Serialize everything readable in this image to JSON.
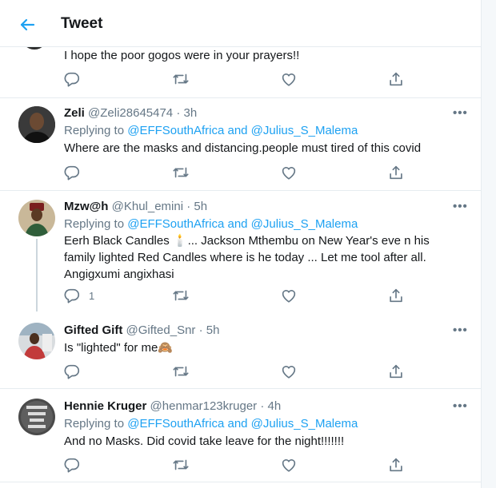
{
  "header": {
    "title": "Tweet"
  },
  "top_partial": {
    "text": "I hope the poor gogos were in your prayers!!"
  },
  "tweets": [
    {
      "name": "Zeli",
      "handle": "@Zeli28645474",
      "time": "· 3h",
      "replying_prefix": "Replying to ",
      "replying_to": "@EFFSouthAfrica and @Julius_S_Malema",
      "text": "Where are the masks and distancing.people must tired of this covid",
      "reply_count": ""
    },
    {
      "name": "Mzw@h",
      "handle": "@Khul_emini",
      "time": "· 5h",
      "replying_prefix": "Replying to ",
      "replying_to": "@EFFSouthAfrica and @Julius_S_Malema",
      "text": "Eerh Black Candles 🕯️... Jackson Mthembu on New Year's eve n his family lighted Red Candles where is he today ... Let me tool after all. Angigxumi angixhasi",
      "reply_count": "1"
    },
    {
      "name": "Gifted Gift",
      "handle": "@Gifted_Snr",
      "time": "· 5h",
      "text": "Is \"lighted\" for me🙈",
      "reply_count": ""
    },
    {
      "name": "Hennie Kruger",
      "handle": "@henmar123kruger",
      "time": "· 4h",
      "replying_prefix": "Replying to ",
      "replying_to": "@EFFSouthAfrica and @Julius_S_Malema",
      "text": "And no Masks. Did covid take leave for the night!!!!!!!",
      "reply_count": ""
    }
  ],
  "icons": {
    "reply": "reply-icon",
    "retweet": "retweet-icon",
    "like": "like-icon",
    "share": "share-icon",
    "more": "more-icon",
    "back": "back-arrow-icon"
  },
  "colors": {
    "accent": "#1da1f2",
    "secondary_text": "#657786",
    "border": "#e6ecf0"
  }
}
